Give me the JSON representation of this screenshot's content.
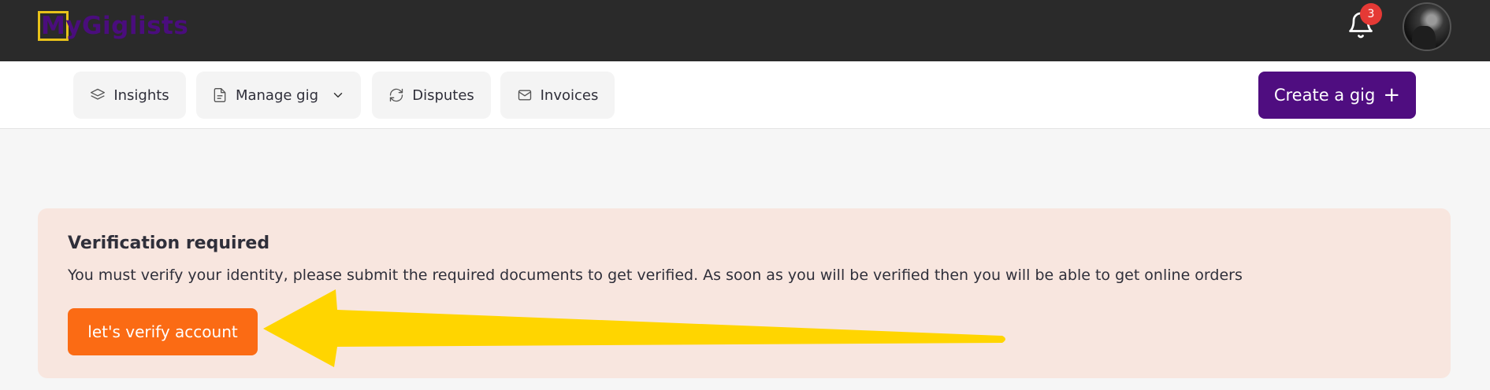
{
  "brand": {
    "name": "MyGiglists",
    "accent": "#4f0d80"
  },
  "header": {
    "notifications": {
      "icon": "bell-icon",
      "count": "3"
    },
    "avatar": {
      "icon": "user-avatar"
    }
  },
  "nav": {
    "tabs": [
      {
        "label": "Insights",
        "icon": "layers-icon"
      },
      {
        "label": "Manage gig",
        "icon": "document-icon",
        "dropdown": true
      },
      {
        "label": "Disputes",
        "icon": "refresh-icon"
      },
      {
        "label": "Invoices",
        "icon": "mail-icon"
      }
    ],
    "create_button": {
      "label": "Create a gig",
      "plus": "+"
    }
  },
  "alert": {
    "title": "Verification required",
    "message": "You must verify your identity, please submit the required documents to get verified. As soon as you will be verified then you will be able to get online orders",
    "button_label": "let's verify account",
    "background": "#f8e6df",
    "button_color": "#fb6b14"
  },
  "annotation": {
    "type": "arrow",
    "color": "#ffd500"
  }
}
